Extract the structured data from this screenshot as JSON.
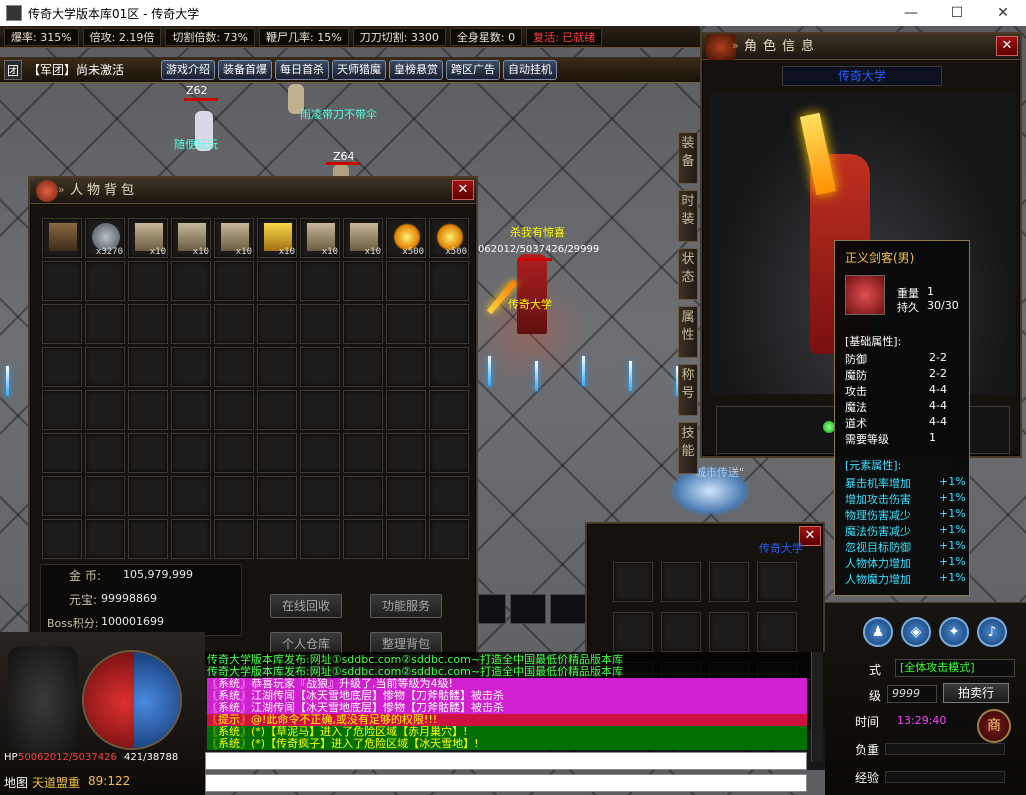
{
  "window": {
    "title": "传奇大学版本库01区 - 传奇大学",
    "min": "—",
    "max": "☐",
    "close": "✕"
  },
  "stats": [
    {
      "label": "爆率: 315%"
    },
    {
      "label": "倍攻: 2.19倍"
    },
    {
      "label": "切割倍数: 73%"
    },
    {
      "label": "鞭尸几率: 15%"
    },
    {
      "label": "刀刀切割: 3300"
    },
    {
      "label": "全身星数: 0"
    },
    {
      "label": "复活: 已就绪",
      "color": "#ff4040"
    }
  ],
  "guild": {
    "prefix": "团",
    "text": "【军团】尚未激活"
  },
  "game_tabs": [
    "游戏介绍",
    "装备首爆",
    "每日首杀",
    "天师猎魔",
    "皇榜悬赏",
    "跨区广告",
    "自动挂机"
  ],
  "scene": {
    "mobs": [
      {
        "name": "Z62",
        "color": "#fff"
      },
      {
        "name": "雨凌带刀不带伞",
        "color": "#5fd"
      },
      {
        "name": "随便玩玩",
        "color": "#5fd"
      },
      {
        "name": "Z64",
        "color": "#fff"
      },
      {
        "name": "杀我有惊喜",
        "color": "#ff0"
      },
      {
        "name": "传奇大学",
        "color": "#ff0"
      },
      {
        "name": "062012/5037426/29999",
        "color": "#fff"
      },
      {
        "name": "\"城市传送\"",
        "color": "#bcd"
      }
    ]
  },
  "bag": {
    "title": "人物背包",
    "items": [
      {
        "icon": "chest-icon",
        "qty": ""
      },
      {
        "icon": "skull-icon",
        "qty": "x3270"
      },
      {
        "icon": "pouch-icon",
        "qty": "x10"
      },
      {
        "icon": "pouch-icon",
        "qty": "x10"
      },
      {
        "icon": "pouch-icon",
        "qty": "x10"
      },
      {
        "icon": "gold-pouch-icon",
        "qty": "x10"
      },
      {
        "icon": "pouch-icon",
        "qty": "x10"
      },
      {
        "icon": "pouch-icon",
        "qty": "x10"
      },
      {
        "icon": "flame-icon",
        "qty": "x500"
      },
      {
        "icon": "flame-icon",
        "qty": "x500"
      }
    ],
    "gold_label": "金 币:",
    "gold_value": "105,979,999",
    "yuanbao_label": "元宝:",
    "yuanbao_value": "99998869",
    "boss_label": "Boss积分:",
    "boss_value": "100001699",
    "buttons": [
      "在线回收",
      "功能服务",
      "个人仓库",
      "整理背包"
    ]
  },
  "character": {
    "title": "角色信息",
    "name": "传奇大学",
    "side_tabs": [
      "装备",
      "时装",
      "状态",
      "属性",
      "称号",
      "技能"
    ]
  },
  "tooltip": {
    "item_name": "正义剑客(男)",
    "weight_label": "重量",
    "weight_value": "1",
    "durability_label": "持久",
    "durability_value": "30/30",
    "base_header": "[基础属性]:",
    "base": [
      {
        "k": "防御",
        "v": "2-2"
      },
      {
        "k": "魔防",
        "v": "2-2"
      },
      {
        "k": "攻击",
        "v": "4-4"
      },
      {
        "k": "魔法",
        "v": "4-4"
      },
      {
        "k": "道术",
        "v": "4-4"
      },
      {
        "k": "需要等级",
        "v": "1"
      }
    ],
    "element_header": "[元素属性]:",
    "element": [
      {
        "k": "暴击机率增加",
        "v": "+1%"
      },
      {
        "k": "增加攻击伤害",
        "v": "+1%"
      },
      {
        "k": "物理伤害减少",
        "v": "+1%"
      },
      {
        "k": "魔法伤害减少",
        "v": "+1%"
      },
      {
        "k": "忽视目标防御",
        "v": "+1%"
      },
      {
        "k": "人物体力增加",
        "v": "+1%"
      },
      {
        "k": "人物魔力增加",
        "v": "+1%"
      }
    ]
  },
  "storage": {
    "owner": "传奇大学"
  },
  "chat": [
    {
      "text": "传奇大学版本库发布:网址①sddbc.com②sddbc.com~打造全中国最低价精品版本库",
      "fg": "#4f4",
      "bg": "transparent"
    },
    {
      "text": "传奇大学版本库发布:网址①sddbc.com②sddbc.com~打造全中国最低价精品版本库",
      "fg": "#4f4",
      "bg": "transparent"
    },
    {
      "text": "〖系统〗恭喜玩家『战狼』升级了,当前等级为4级!",
      "fg": "#fff",
      "bg": "#d020d0"
    },
    {
      "text": "〖系统〗江湖传闻【冰天雪地底层】惨物【刀斧骷髅】被击杀",
      "fg": "#fff",
      "bg": "#d020d0"
    },
    {
      "text": "〖系统〗江湖传闻【冰天雪地底层】惨物【刀斧骷髅】被击杀",
      "fg": "#fff",
      "bg": "#d020d0"
    },
    {
      "text": "〖提示〗@!此命令不正确,或没有足够的权限!!!",
      "fg": "#ff0",
      "bg": "#d01040"
    },
    {
      "text": "〖系统〗(*)【草泥马】进入了危险区域【赤月巢穴】!",
      "fg": "#ff0",
      "bg": "#007000"
    },
    {
      "text": "〖系统〗(*)【传奇疯子】进入了危险区域【冰天雪地】!",
      "fg": "#ff0",
      "bg": "#007000"
    }
  ],
  "hud": {
    "hp_label": "HP",
    "hp_value": "50062012/5037426",
    "mp_value": "421/38788",
    "map_label": "地图",
    "map_name": "天道盟重",
    "map_coords": "89:122",
    "mode_label": "式",
    "mode_value": "[全体攻击模式]",
    "level_label": "级",
    "level_value": "9999",
    "auction": "拍卖行",
    "time_label": "时间",
    "time_value": "13:29:40",
    "weight_label": "负重",
    "exp_label": "经验",
    "shop_glyph": "商"
  },
  "colors": {
    "accent": "#f3c040",
    "hp": "#c01818",
    "mp": "#2a6ad0",
    "cyan": "#39e0ff"
  }
}
